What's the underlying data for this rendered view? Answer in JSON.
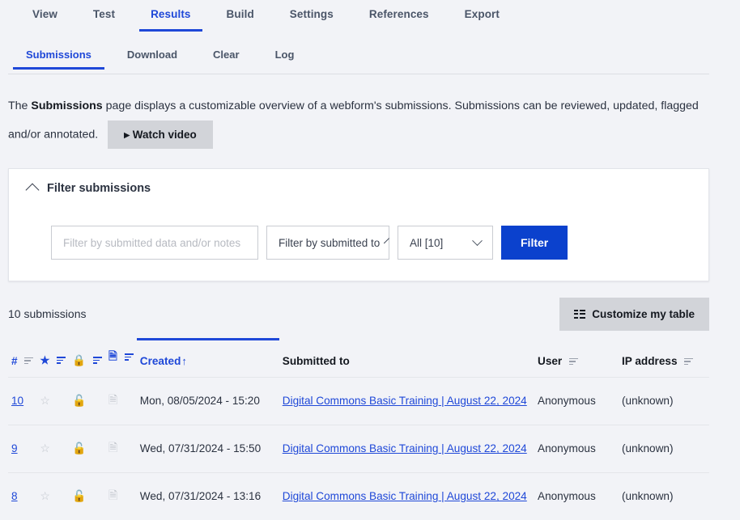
{
  "primary_tabs": [
    {
      "label": "View",
      "active": false
    },
    {
      "label": "Test",
      "active": false
    },
    {
      "label": "Results",
      "active": true
    },
    {
      "label": "Build",
      "active": false
    },
    {
      "label": "Settings",
      "active": false
    },
    {
      "label": "References",
      "active": false
    },
    {
      "label": "Export",
      "active": false
    }
  ],
  "secondary_tabs": [
    {
      "label": "Submissions",
      "active": true
    },
    {
      "label": "Download",
      "active": false
    },
    {
      "label": "Clear",
      "active": false
    },
    {
      "label": "Log",
      "active": false
    }
  ],
  "intro": {
    "part1": "The ",
    "bold": "Submissions",
    "part2": " page displays a customizable overview of a webform's submissions. Submissions can be reviewed, updated, flagged and/or annotated.",
    "watch_video_label": "▸ Watch video"
  },
  "filter_panel": {
    "title": "Filter submissions",
    "collapse_icon": "chevron-up-icon",
    "search_placeholder": "Filter by submitted data and/or notes",
    "search_value": "",
    "submitted_to_label": "Filter by submitted to",
    "state_label": "All [10]",
    "filter_button": "Filter"
  },
  "results": {
    "count_label": "10 submissions",
    "customize_label": "Customize my table"
  },
  "table": {
    "headers": {
      "num": "#",
      "star": "★",
      "lock": "🔒",
      "note": "🗎",
      "created": "Created",
      "sort_arrow": "↑",
      "submitted_to": "Submitted to",
      "user": "User",
      "ip_address": "IP address"
    },
    "rows": [
      {
        "num": "10",
        "star": "☆",
        "lock": "🔓",
        "note": "🗎",
        "created": "Mon, 08/05/2024 - 15:20",
        "submitted_to": "Digital Commons Basic Training | August 22, 2024",
        "user": "Anonymous",
        "ip_address": "(unknown)"
      },
      {
        "num": "9",
        "star": "☆",
        "lock": "🔓",
        "note": "🗎",
        "created": "Wed, 07/31/2024 - 15:50",
        "submitted_to": "Digital Commons Basic Training | August 22, 2024",
        "user": "Anonymous",
        "ip_address": "(unknown)"
      },
      {
        "num": "8",
        "star": "☆",
        "lock": "🔓",
        "note": "🗎",
        "created": "Wed, 07/31/2024 - 13:16",
        "submitted_to": "Digital Commons Basic Training | August 22, 2024",
        "user": "Anonymous",
        "ip_address": "(unknown)"
      }
    ]
  },
  "colors": {
    "accent": "#1f48d8",
    "button_blue": "#0b41cd",
    "page_bg": "#f2f3f7",
    "card_bg": "#ffffff",
    "gray_button": "#d2d4d9",
    "text": "#2b3240"
  }
}
